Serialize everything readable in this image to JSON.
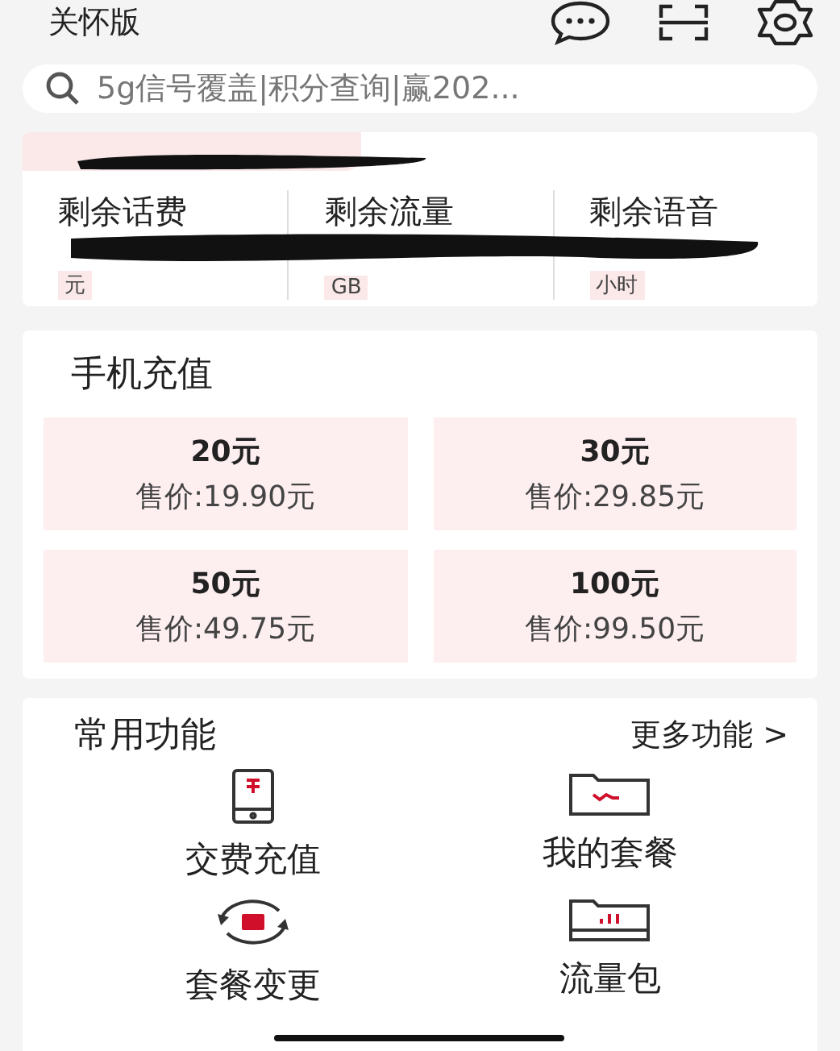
{
  "header": {
    "title": "关怀版"
  },
  "search": {
    "placeholder": "5g信号覆盖|积分查询|赢202..."
  },
  "balances": [
    {
      "label": "剩余话费",
      "unit": "元"
    },
    {
      "label": "剩余流量",
      "unit": "GB"
    },
    {
      "label": "剩余语音",
      "unit": "小时"
    }
  ],
  "recharge": {
    "title": "手机充值",
    "options": [
      {
        "amount": "20元",
        "price": "售价:19.90元"
      },
      {
        "amount": "30元",
        "price": "售价:29.85元"
      },
      {
        "amount": "50元",
        "price": "售价:49.75元"
      },
      {
        "amount": "100元",
        "price": "售价:99.50元"
      }
    ]
  },
  "functions": {
    "title": "常用功能",
    "more": "更多功能 >",
    "items": [
      {
        "kind": "phone-yuan",
        "label": "交费充值"
      },
      {
        "kind": "folder-wave",
        "label": "我的套餐"
      },
      {
        "kind": "cycle",
        "label": "套餐变更"
      },
      {
        "kind": "folder-bars",
        "label": "流量包"
      }
    ]
  }
}
